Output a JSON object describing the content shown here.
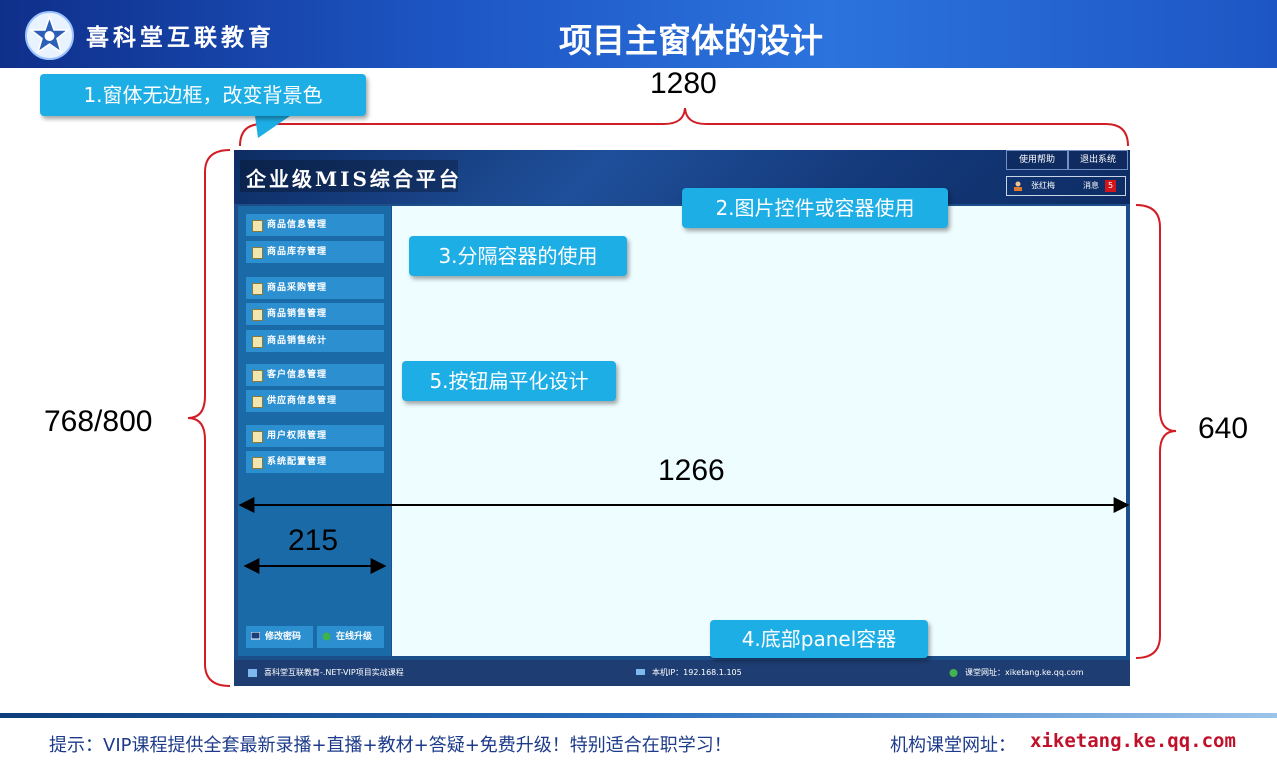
{
  "header": {
    "org_name": "喜科堂互联教育",
    "title": "项目主窗体的设计",
    "logo_icon": "star-logo-icon"
  },
  "dimensions": {
    "width_total": "1280",
    "height_total": "768/800",
    "content_height": "640",
    "content_width": "1266",
    "sidebar_width": "215"
  },
  "callouts": [
    "1.窗体无边框，改变背景色",
    "2.图片控件或容器使用",
    "3.分隔容器的使用",
    "4.底部panel容器",
    "5.按钮扁平化设计"
  ],
  "mock": {
    "title": "企业级MIS综合平台",
    "help_label": "使用帮助",
    "exit_label": "退出系统",
    "user_name": "张红梅",
    "msg_label": "消息",
    "msg_count": "5",
    "nav": [
      "商品信息管理",
      "商品库存管理",
      "商品采购管理",
      "商品销售管理",
      "商品销售统计",
      "客户信息管理",
      "供应商信息管理",
      "用户权限管理",
      "系统配置管理"
    ],
    "bottom_buttons": [
      "修改密码",
      "在线升级"
    ],
    "footer": {
      "left": "喜科堂互联教育-.NET-VIP项目实战课程",
      "ip": "本机IP：192.168.1.105",
      "site": "课堂网址：xiketang.ke.qq.com"
    }
  },
  "footer": {
    "tip": "提示：VIP课程提供全套最新录播+直播+教材+答疑+免费升级！特别适合在职学习！",
    "site_label": "机构课堂网址：",
    "site_url": "xiketang.ke.qq.com"
  },
  "colors": {
    "accent": "#1eaee6",
    "header_blue": "#1d56c4",
    "content_bg": "#eefdff",
    "url_red": "#c0112a"
  }
}
